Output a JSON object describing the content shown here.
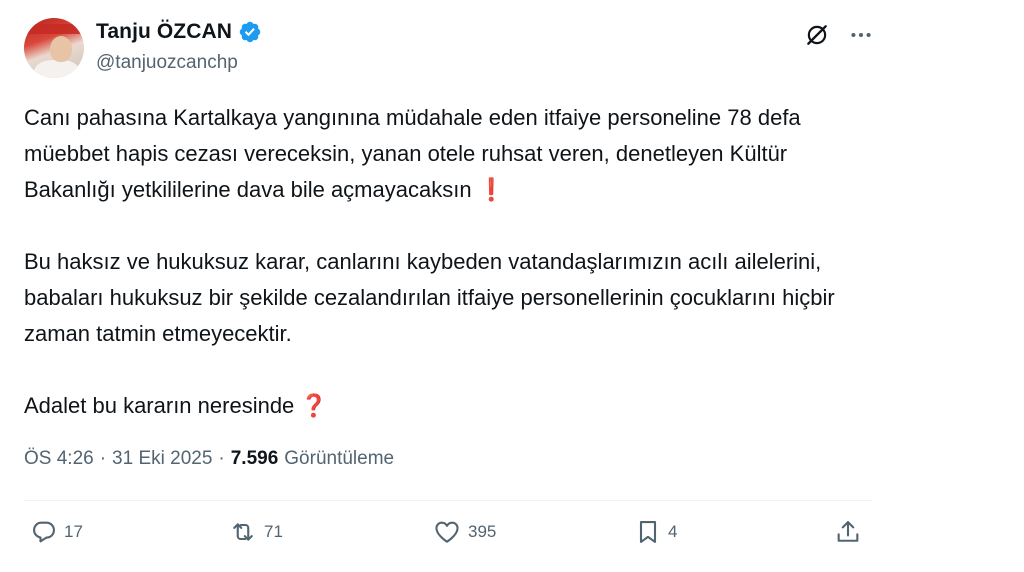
{
  "author": {
    "name": "Tanju ÖZCAN",
    "handle": "@tanjuozcanchp",
    "verified": true
  },
  "tweet": {
    "paragraphs": [
      {
        "text": "Canı pahasına Kartalkaya yangınına müdahale eden itfaiye personeline 78 defa müebbet hapis cezası vereceksin, yanan otele ruhsat veren, denetleyen Kültür Bakanlığı yetkililerine dava bile açmayacaksın",
        "emoji": "❗"
      },
      {
        "text": "Bu haksız ve hukuksuz karar, canlarını kaybeden vatandaşlarımızın acılı ailelerini, babaları hukuksuz bir şekilde cezalandırılan itfaiye personellerinin çocuklarını hiçbir zaman tatmin etmeyecektir.",
        "emoji": ""
      },
      {
        "text": "Adalet bu kararın neresinde",
        "emoji": "❓"
      }
    ]
  },
  "meta": {
    "time": "ÖS 4:26",
    "separator": "·",
    "date": "31 Eki 2025",
    "views_count": "7.596",
    "views_label": "Görüntüleme"
  },
  "actions": {
    "replies": "17",
    "reposts": "71",
    "likes": "395",
    "bookmarks": "4"
  },
  "colors": {
    "text": "#0f1419",
    "secondary": "#536471",
    "verified": "#1d9bf0",
    "emoji_red": "#d0283a",
    "divider": "#eff3f4"
  },
  "icons": [
    "verified-badge-icon",
    "grok-icon",
    "more-icon",
    "reply-icon",
    "repost-icon",
    "like-icon",
    "bookmark-icon",
    "share-icon"
  ]
}
